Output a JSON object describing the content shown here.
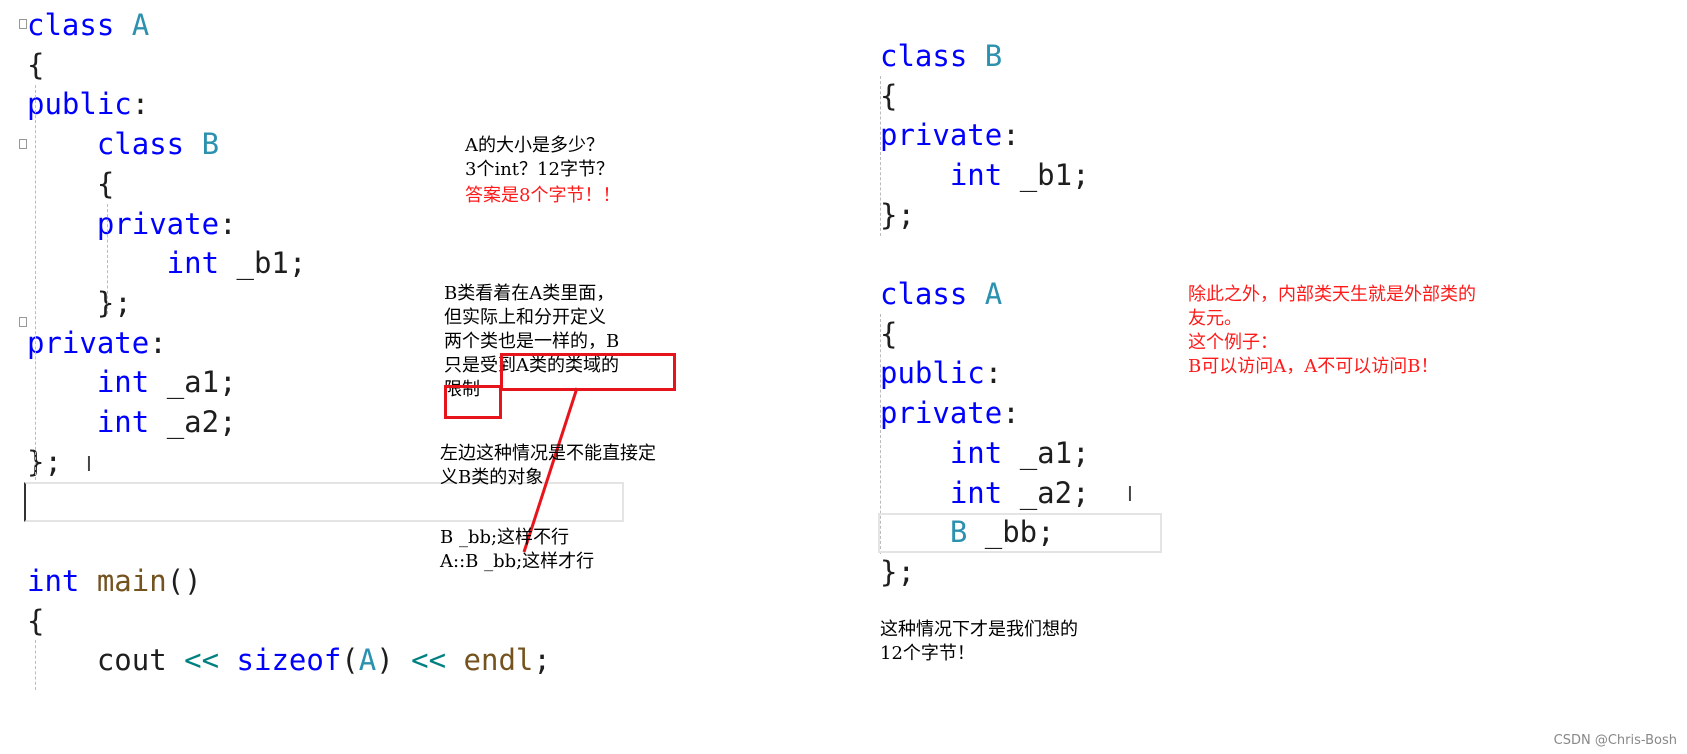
{
  "left_code": [
    [
      [
        "class ",
        "kw"
      ],
      [
        "A",
        "ty"
      ]
    ],
    [
      [
        "{",
        "id"
      ]
    ],
    [
      [
        "public",
        "kw"
      ],
      [
        ":",
        "id"
      ]
    ],
    [
      [
        "    class ",
        "kw"
      ],
      [
        "B",
        "ty"
      ]
    ],
    [
      [
        "    {",
        "id"
      ]
    ],
    [
      [
        "    private",
        "kw"
      ],
      [
        ":",
        "id"
      ]
    ],
    [
      [
        "        int ",
        "kw"
      ],
      [
        "_b1;",
        "id"
      ]
    ],
    [
      [
        "    };",
        "id"
      ]
    ],
    [
      [
        "private",
        "kw"
      ],
      [
        ":",
        "id"
      ]
    ],
    [
      [
        "    int ",
        "kw"
      ],
      [
        "_a1;",
        "id"
      ]
    ],
    [
      [
        "    int ",
        "kw"
      ],
      [
        "_a2;",
        "id"
      ]
    ],
    [
      [
        "};",
        "id"
      ]
    ],
    [],
    [],
    [
      [
        "int ",
        "kw"
      ],
      [
        "main",
        "fn"
      ],
      [
        "()",
        "id"
      ]
    ],
    [
      [
        "{",
        "id"
      ]
    ],
    [
      [
        "    cout ",
        "id"
      ],
      [
        "<< ",
        "op"
      ],
      [
        "sizeof",
        "kw"
      ],
      [
        "(",
        "id"
      ],
      [
        "A",
        "ty"
      ],
      [
        ") ",
        "id"
      ],
      [
        "<< ",
        "op"
      ],
      [
        "endl",
        "fn"
      ],
      [
        ";",
        "id"
      ]
    ]
  ],
  "right_code_b": [
    [
      [
        "class ",
        "kw"
      ],
      [
        "B",
        "ty"
      ]
    ],
    [
      [
        "{",
        "id"
      ]
    ],
    [
      [
        "private",
        "kw"
      ],
      [
        ":",
        "id"
      ]
    ],
    [
      [
        "    int ",
        "kw"
      ],
      [
        "_b1;",
        "id"
      ]
    ],
    [
      [
        "};",
        "id"
      ]
    ]
  ],
  "right_code_a": [
    [
      [
        "class ",
        "kw"
      ],
      [
        "A",
        "ty"
      ]
    ],
    [
      [
        "{",
        "id"
      ]
    ],
    [
      [
        "public",
        "kw"
      ],
      [
        ":",
        "id"
      ]
    ],
    [
      [
        "private",
        "kw"
      ],
      [
        ":",
        "id"
      ]
    ],
    [
      [
        "    int ",
        "kw"
      ],
      [
        "_a1;",
        "id"
      ]
    ],
    [
      [
        "    int ",
        "kw"
      ],
      [
        "_a2;",
        "id"
      ]
    ],
    [
      [
        "    B ",
        "ty"
      ],
      [
        "_bb;",
        "id"
      ]
    ],
    [
      [
        "};",
        "id"
      ]
    ]
  ],
  "notes": {
    "size_question": "A的大小是多少？\n3个int？12字节？",
    "size_answer": "答案是8个字节！！",
    "nested_explain": "B类看着在A类里面，\n但实际上和分开定义\n两个类也是一样的，B\n只是受到A类的类域的\n限制",
    "left_case": "左边这种情况是不能直接定\n义B类的对象",
    "usage": "B _bb;这样不行\nA::B _bb;这样才行",
    "friend": "除此之外，内部类天生就是外部类的\n友元。\n这个例子：\nB可以访问A，A不可以访问B！",
    "right_case": "这种情况下才是我们想的\n12个字节！"
  },
  "watermark": "CSDN @Chris-Bosh",
  "colors": {
    "keyword": "#0000ff",
    "type": "#2b91af",
    "function": "#74531f",
    "annotation_red": "#e8141b"
  }
}
